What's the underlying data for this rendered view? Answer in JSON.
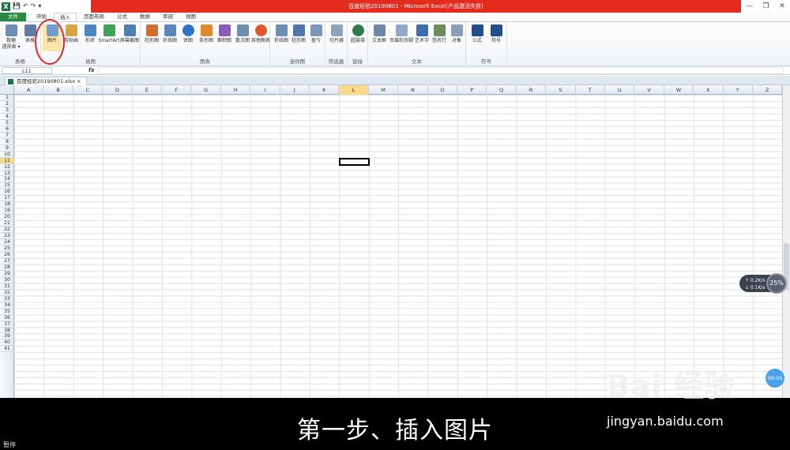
{
  "window": {
    "title": "百度经验20190801 - Microsoft Excel(产品激活失败)"
  },
  "qat": {
    "items": [
      "X",
      "💾",
      "↶",
      "↷",
      "▾"
    ]
  },
  "window_controls": [
    "—",
    "❐",
    "✕"
  ],
  "tabs": [
    {
      "label": "文件"
    },
    {
      "label": "开始"
    },
    {
      "label": "插入"
    },
    {
      "label": "页面布局"
    },
    {
      "label": "公式"
    },
    {
      "label": "数据"
    },
    {
      "label": "审阅"
    },
    {
      "label": "视图"
    }
  ],
  "ribbon": {
    "groups": [
      {
        "label": "表格"
      },
      {
        "label": "插图"
      },
      {
        "label": "图表"
      },
      {
        "label": "迷你图"
      },
      {
        "label": "筛选器"
      },
      {
        "label": "链接"
      },
      {
        "label": "文本"
      },
      {
        "label": "符号"
      }
    ],
    "buttons": [
      {
        "label": "数据\n透视表 ▾",
        "color": "#6a8fb8"
      },
      {
        "label": "表格",
        "color": "#5b7fa6"
      },
      {
        "label": "图片",
        "color": "#6f9ecf"
      },
      {
        "label": "剪贴画",
        "color": "#d9a441"
      },
      {
        "label": "形状",
        "color": "#4a86c5"
      },
      {
        "label": "SmartArt",
        "color": "#3fa35a"
      },
      {
        "label": "屏幕截图",
        "color": "#4d7fb5"
      },
      {
        "label": "柱形图",
        "color": "#d56b2d"
      },
      {
        "label": "折线图",
        "color": "#5b87c0"
      },
      {
        "label": "饼图",
        "color": "#2f73c4"
      },
      {
        "label": "条形图",
        "color": "#e28a2a"
      },
      {
        "label": "面积图",
        "color": "#8a5bb8"
      },
      {
        "label": "散点图",
        "color": "#6d8fb0"
      },
      {
        "label": "其他图表",
        "color": "#e0582a"
      },
      {
        "label": "折线图",
        "color": "#6b8db6"
      },
      {
        "label": "柱形图",
        "color": "#4a78ad"
      },
      {
        "label": "盈亏",
        "color": "#7a96b8"
      },
      {
        "label": "切片器",
        "color": "#8ba4c0"
      },
      {
        "label": "超链接",
        "color": "#2f7a4b"
      },
      {
        "label": "文本框",
        "color": "#6d88a8"
      },
      {
        "label": "页眉和页脚",
        "color": "#8faac8"
      },
      {
        "label": "艺术字",
        "color": "#3a6fb0"
      },
      {
        "label": "签名行",
        "color": "#6c8c5a"
      },
      {
        "label": "对象",
        "color": "#8aa0ba"
      },
      {
        "label": "公式",
        "color": "#1f4f8c"
      },
      {
        "label": "符号",
        "color": "#1f4f8c"
      }
    ]
  },
  "formula_bar": {
    "name_box": "L11",
    "fx": "fx",
    "value": ""
  },
  "workbook": {
    "tab": "百度经验20190801.xlsx ×"
  },
  "sheet": {
    "columns": [
      "A",
      "B",
      "C",
      "D",
      "E",
      "F",
      "G",
      "H",
      "I",
      "J",
      "K",
      "L",
      "M",
      "N",
      "O",
      "P",
      "Q",
      "R",
      "S",
      "T",
      "U",
      "V",
      "W",
      "X",
      "Y",
      "Z"
    ],
    "rows": [
      "1",
      "2",
      "3",
      "4",
      "5",
      "6",
      "7",
      "8",
      "9",
      "10",
      "11",
      "12",
      "13",
      "14",
      "15",
      "16",
      "17",
      "18",
      "19",
      "20",
      "21",
      "22",
      "23",
      "24",
      "25",
      "26",
      "27",
      "28",
      "29",
      "30",
      "31",
      "32",
      "33",
      "34",
      "35",
      "36",
      "37",
      "38",
      "39",
      "40",
      "41"
    ],
    "selected_column": "L",
    "selected_row": "11"
  },
  "netmon": {
    "up": "↑ 0.2K/s",
    "down": "↓ 0.1K/s",
    "percent": "25%"
  },
  "timer": "00:05",
  "caption": "第一步、插入图片",
  "pause_label": "暂停",
  "watermark": {
    "logo": "Bai 经验",
    "url": "jingyan.baidu.com"
  }
}
